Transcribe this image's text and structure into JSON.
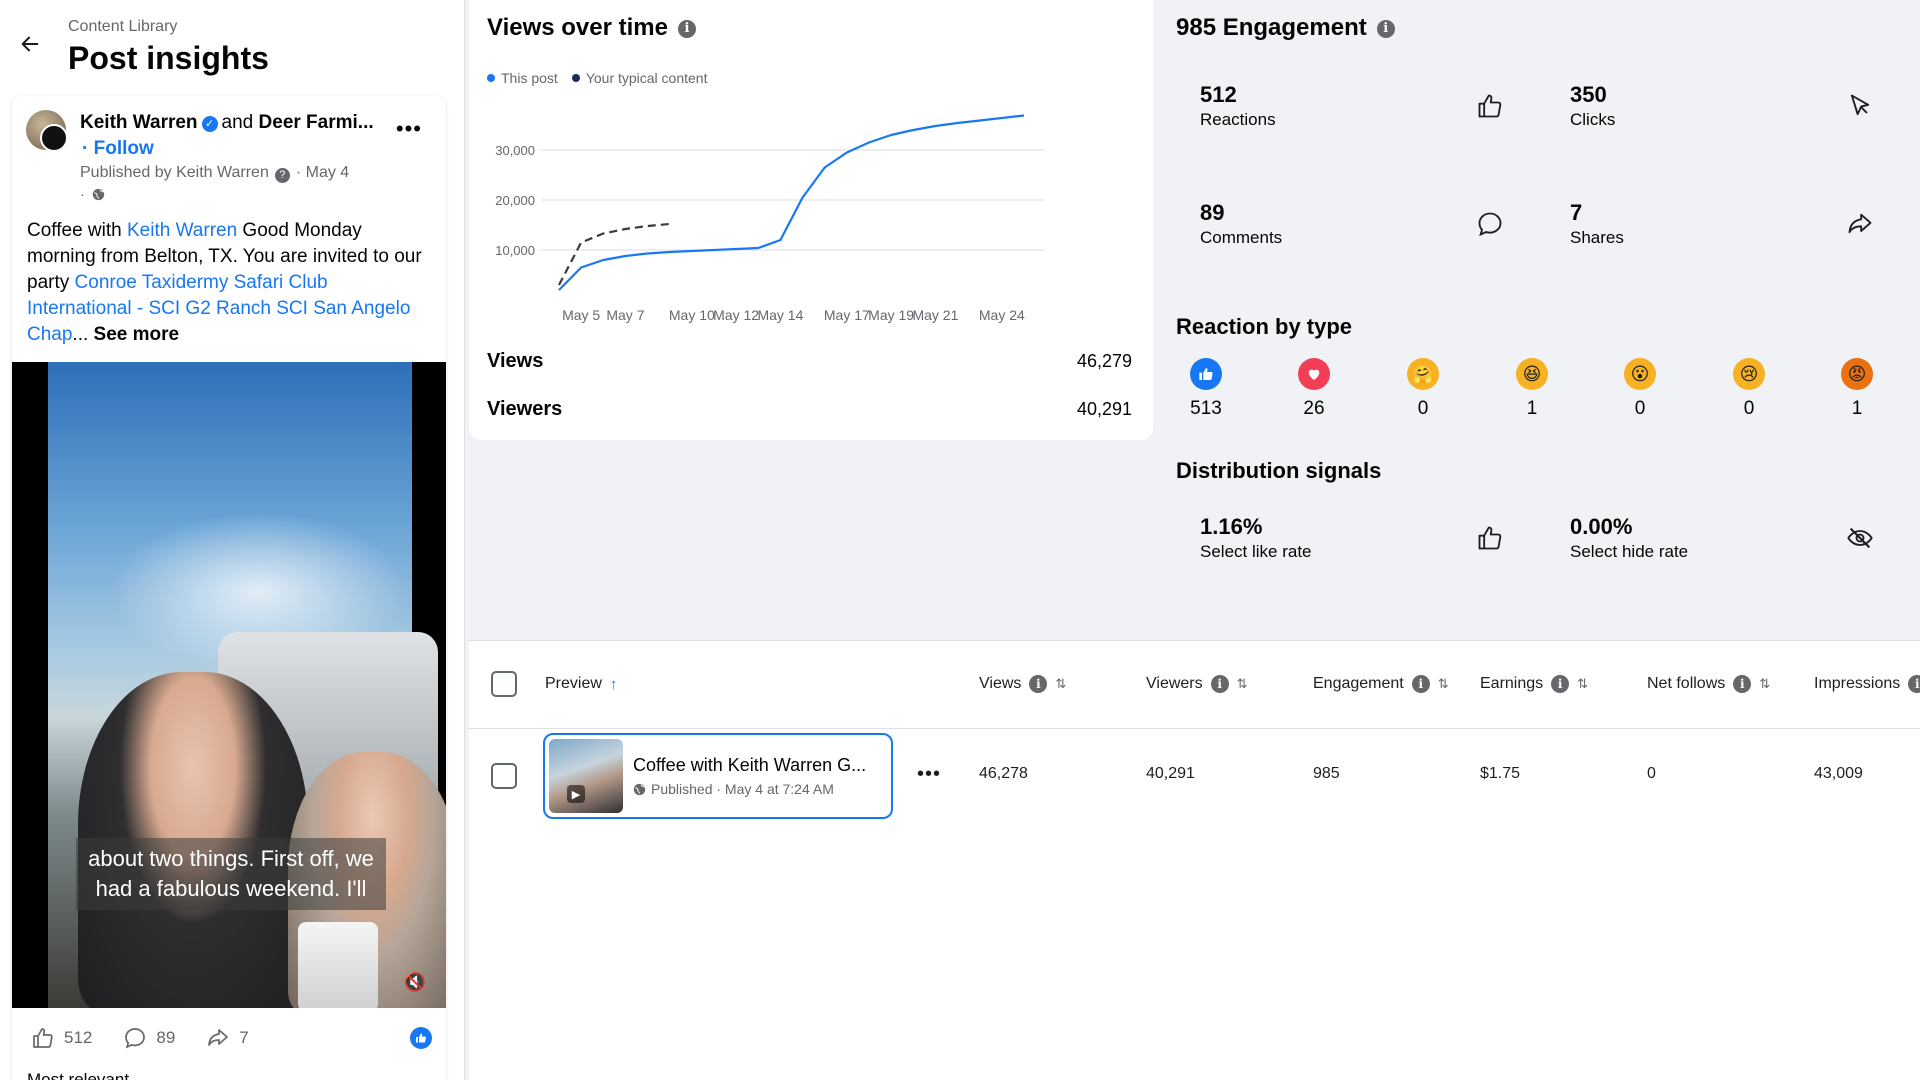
{
  "header": {
    "breadcrumb": "Content Library",
    "title": "Post insights"
  },
  "post": {
    "author": "Keith Warren",
    "and_text": "and",
    "coauthor": "Deer Farmi...",
    "follow": "· Follow",
    "published_by": "Published by Keith Warren",
    "date": "· May 4",
    "dot": "·",
    "body_prefix": "Coffee with ",
    "body_link1": "Keith Warren",
    "body_mid": " Good Monday morning from Belton, TX. You are invited to our party ",
    "body_link2": "Conroe Taxidermy Safari Club International - SCI G2 Ranch SCI San Angelo Chap",
    "body_ellipsis": "...",
    "see_more": " See more",
    "caption_line1": "about two things. First off, we",
    "caption_line2": "had a fabulous weekend. I'll",
    "likes": "512",
    "comments": "89",
    "shares": "7",
    "most_relevant": "Most relevant"
  },
  "views_card": {
    "title": "Views over time",
    "legend": [
      {
        "label": "This post",
        "color": "#1877f2"
      },
      {
        "label": "Your typical content",
        "color": "#1c2b5a"
      }
    ],
    "views_label": "Views",
    "views_value": "46,279",
    "viewers_label": "Viewers",
    "viewers_value": "40,291"
  },
  "chart_data": {
    "type": "line",
    "x": [
      "May 4",
      "May 5",
      "May 6",
      "May 7",
      "May 8",
      "May 9",
      "May 10",
      "May 11",
      "May 12",
      "May 13",
      "May 14",
      "May 15",
      "May 16",
      "May 17",
      "May 18",
      "May 19",
      "May 20",
      "May 21",
      "May 22",
      "May 23",
      "May 24",
      "May 25"
    ],
    "x_tick_labels": [
      "May 5",
      "May 7",
      "May 10",
      "May 12",
      "May 14",
      "May 17",
      "May 19",
      "May 21",
      "May 24"
    ],
    "y_tick_labels": [
      "30,000",
      "20,000",
      "10,000"
    ],
    "series": [
      {
        "name": "This post",
        "style": "solid",
        "color": "#1877f2",
        "values": [
          2000,
          6500,
          8000,
          8800,
          9300,
          9600,
          9800,
          10000,
          10200,
          10400,
          12000,
          20500,
          26500,
          29500,
          31500,
          33000,
          34000,
          34800,
          35400,
          35900,
          36400,
          36900
        ]
      },
      {
        "name": "Your typical content",
        "style": "dashed",
        "color": "#3a3b3c",
        "values": [
          3000,
          11500,
          13300,
          14200,
          14800,
          15200
        ]
      }
    ],
    "ylim": [
      0,
      40000
    ],
    "grid": true
  },
  "engagement": {
    "title": "985 Engagement",
    "tiles": [
      {
        "value": "512",
        "label": "Reactions",
        "icon": "thumbs-up-icon"
      },
      {
        "value": "350",
        "label": "Clicks",
        "icon": "cursor-icon"
      },
      {
        "value": "89",
        "label": "Comments",
        "icon": "comment-icon"
      },
      {
        "value": "7",
        "label": "Shares",
        "icon": "share-icon"
      }
    ],
    "reaction_title": "Reaction by type",
    "reactions": [
      {
        "type": "like",
        "count": "513",
        "color": "#1877f2"
      },
      {
        "type": "love",
        "count": "26",
        "color": "#f33e58"
      },
      {
        "type": "care",
        "count": "0",
        "color": "#f7b125"
      },
      {
        "type": "haha",
        "count": "1",
        "color": "#f7b125"
      },
      {
        "type": "wow",
        "count": "0",
        "color": "#f7b125"
      },
      {
        "type": "sad",
        "count": "0",
        "color": "#f7b125"
      },
      {
        "type": "angry",
        "count": "1",
        "color": "#e9710f"
      }
    ],
    "distribution_title": "Distribution signals",
    "signals": [
      {
        "value": "1.16%",
        "label": "Select like rate",
        "icon": "thumbs-up-icon"
      },
      {
        "value": "0.00%",
        "label": "Select hide rate",
        "icon": "eye-off-icon"
      }
    ]
  },
  "table": {
    "columns": [
      "Preview",
      "Views",
      "Viewers",
      "Engagement",
      "Earnings",
      "Net follows",
      "Impressions"
    ],
    "row": {
      "title": "Coffee with Keith Warren G...",
      "meta": "Published · May 4 at 7:24 AM",
      "views": "46,278",
      "viewers": "40,291",
      "engagement": "985",
      "earnings": "$1.75",
      "net_follows": "0",
      "impressions": "43,009"
    }
  }
}
